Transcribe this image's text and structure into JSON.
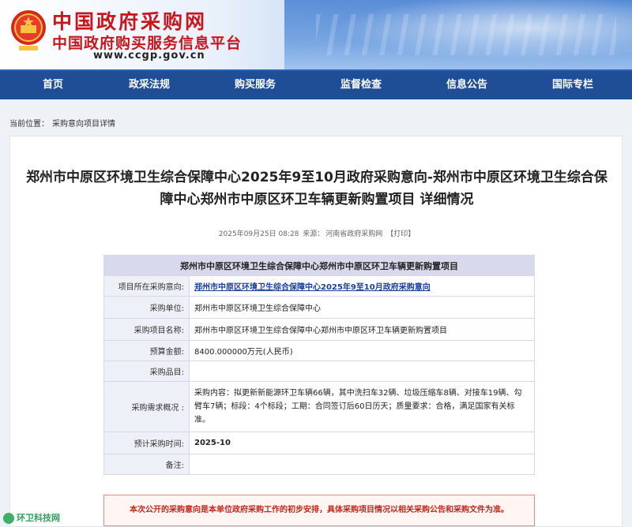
{
  "header": {
    "site_name": "中国政府采购网",
    "site_subtitle": "中国政府购买服务信息平台",
    "site_url": "www.ccgp.gov.cn"
  },
  "nav": {
    "items": [
      "首页",
      "政采法规",
      "购买服务",
      "监督检查",
      "信息公告",
      "国际专栏"
    ]
  },
  "breadcrumb": {
    "label": "当前位置：",
    "current": "采购意向项目详情"
  },
  "article": {
    "title": "郑州市中原区环境卫生综合保障中心2025年9至10月政府采购意向-郑州市中原区环境卫生综合保障中心郑州市中原区环卫车辆更新购置项目 详细情况",
    "date": "2025年09月25日 08:28",
    "source_label": "来源：",
    "source": "河南省政府采购网",
    "print_label": "【打印】"
  },
  "table": {
    "header": "郑州市中原区环境卫生综合保障中心郑州市中原区环卫车辆更新购置项目",
    "rows": [
      {
        "label": "项目所在采购意向:",
        "value": "郑州市中原区环境卫生综合保障中心2025年9至10月政府采购意向"
      },
      {
        "label": "采购单位:",
        "value": "郑州市中原区环境卫生综合保障中心"
      },
      {
        "label": "采购项目名称:",
        "value": "郑州市中原区环境卫生综合保障中心郑州市中原区环卫车辆更新购置项目"
      },
      {
        "label": "预算金额:",
        "value": "8400.000000万元(人民币)"
      },
      {
        "label": "采购品目:",
        "value": ""
      },
      {
        "label": "采购需求概况 :",
        "value": "采购内容：拟更新新能源环卫车辆66辆，其中洗扫车32辆、垃圾压缩车8辆、对接车19辆、勾臂车7辆；标段：4个标段；工期：合同签订后60日历天；质量要求：合格，满足国家有关标准。"
      },
      {
        "label": "预计采购时间:",
        "value": "2025-10"
      },
      {
        "label": "备注:",
        "value": ""
      }
    ]
  },
  "notice": "本次公开的采购意向是本单位政府采购工作的初步安排，具体采购项目情况以相关采购公告和采购文件为准。",
  "watermark": "环卫科技网"
}
